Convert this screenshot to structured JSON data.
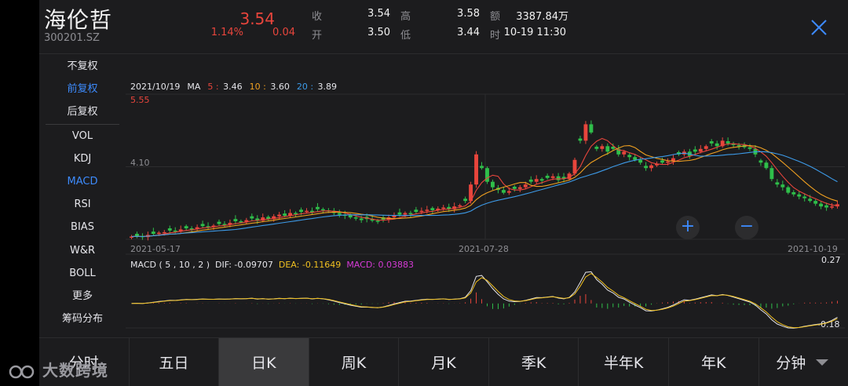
{
  "stock": {
    "name": "海伦哲",
    "code": "300201.SZ",
    "price": "3.54",
    "change_pct": "1.14%",
    "change": "0.04"
  },
  "quote": {
    "close_label": "收",
    "close": "3.54",
    "open_label": "开",
    "open": "3.50",
    "high_label": "高",
    "high": "3.58",
    "low_label": "低",
    "low": "3.44",
    "amount_label": "额",
    "amount": "3387.84万",
    "time_label": "时",
    "time": "10-19 11:30"
  },
  "side_menu": {
    "fq": [
      "不复权",
      "前复权",
      "后复权"
    ],
    "indicators": [
      "VOL",
      "KDJ",
      "MACD",
      "RSI",
      "BIAS",
      "W&R",
      "BOLL",
      "更多",
      "筹码分布"
    ],
    "active_fq": "前复权",
    "active_indicator": "MACD"
  },
  "ma_info": {
    "date": "2021/10/19",
    "ma_label": "MA",
    "ma5_label": "5 :",
    "ma5": "3.46",
    "ma10_label": "10 :",
    "ma10": "3.60",
    "ma20_label": "20 :",
    "ma20": "3.89"
  },
  "axis": {
    "high_mark": "5.55",
    "mid_mark": "4.10",
    "x_start": "2021-05-17",
    "x_mid": "2021-07-28",
    "x_end": "2021-10-19",
    "macd_top": "0.27",
    "macd_bottom": "-0.18"
  },
  "macd_info": {
    "label": "MACD ( 5 , 10 , 2 )",
    "dif": "DIF: -0.09707",
    "dea": "DEA: -0.11649",
    "macd": "MACD: 0.03883"
  },
  "zoom": {
    "in": "+",
    "out": "−"
  },
  "tabs": [
    "分时",
    "五日",
    "日K",
    "周K",
    "月K",
    "季K",
    "半年K",
    "年K",
    "分钟"
  ],
  "active_tab": "日K",
  "watermark": "大数跨境",
  "colors": {
    "up": "#e8453c",
    "down": "#2fbf4a",
    "ma5": "#e8453c",
    "ma10": "#f0a020",
    "ma20": "#3d9be9",
    "accent": "#3d8bfd",
    "macd": "#d63ad6",
    "dea": "#f0c020"
  },
  "chart_data": {
    "type": "candlestick",
    "x_range": [
      "2021-05-17",
      "2021-10-19"
    ],
    "y_range": [
      2.9,
      5.55
    ],
    "closes": [
      2.95,
      2.96,
      2.94,
      2.98,
      3.0,
      3.02,
      3.03,
      3.06,
      3.04,
      3.08,
      3.1,
      3.09,
      3.12,
      3.14,
      3.13,
      3.15,
      3.18,
      3.17,
      3.2,
      3.23,
      3.22,
      3.25,
      3.28,
      3.24,
      3.3,
      3.27,
      3.32,
      3.35,
      3.33,
      3.38,
      3.36,
      3.4,
      3.42,
      3.39,
      3.45,
      3.43,
      3.41,
      3.38,
      3.35,
      3.33,
      3.3,
      3.28,
      3.25,
      3.27,
      3.24,
      3.22,
      3.26,
      3.3,
      3.33,
      3.35,
      3.38,
      3.36,
      3.4,
      3.42,
      3.44,
      3.43,
      3.46,
      3.48,
      3.45,
      3.5,
      3.52,
      3.6,
      3.9,
      4.45,
      4.2,
      3.95,
      3.85,
      3.8,
      3.75,
      3.78,
      3.82,
      3.85,
      3.9,
      3.95,
      4.0,
      3.97,
      4.02,
      4.05,
      3.98,
      4.0,
      4.1,
      4.35,
      4.7,
      5.0,
      4.85,
      4.55,
      4.6,
      4.5,
      4.55,
      4.45,
      4.5,
      4.4,
      4.35,
      4.3,
      4.2,
      4.25,
      4.28,
      4.3,
      4.32,
      4.38,
      4.45,
      4.5,
      4.42,
      4.5,
      4.55,
      4.6,
      4.65,
      4.6,
      4.7,
      4.65,
      4.62,
      4.6,
      4.58,
      4.55,
      4.45,
      4.3,
      4.2,
      4.0,
      3.9,
      3.85,
      3.75,
      3.72,
      3.68,
      3.65,
      3.6,
      3.55,
      3.5,
      3.48,
      3.5,
      3.54
    ],
    "ma5": "MA5 3.46",
    "ma10": "MA10 3.60",
    "ma20": "MA20 3.89"
  }
}
